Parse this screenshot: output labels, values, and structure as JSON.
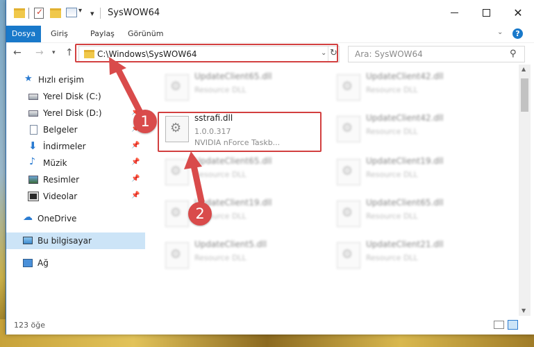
{
  "titlebar": {
    "title": "SysWOW64",
    "minimize": "—",
    "maximize": "□",
    "close": "✕"
  },
  "ribbon": {
    "tabs": [
      "Dosya",
      "Giriş",
      "Paylaş",
      "Görünüm"
    ]
  },
  "address": {
    "path": "C:\\Windows\\SysWOW64",
    "search_placeholder": "Ara: SysWOW64"
  },
  "sidebar": {
    "items": [
      {
        "label": "Hızlı erişim",
        "icon": "star-icon",
        "pinned": false
      },
      {
        "label": "Yerel Disk (C:)",
        "icon": "disk-icon",
        "pinned": true
      },
      {
        "label": "Yerel Disk (D:)",
        "icon": "disk-icon",
        "pinned": true
      },
      {
        "label": "Belgeler",
        "icon": "document-icon",
        "pinned": true
      },
      {
        "label": "İndirmeler",
        "icon": "download-icon",
        "pinned": true
      },
      {
        "label": "Müzik",
        "icon": "music-icon",
        "pinned": true
      },
      {
        "label": "Resimler",
        "icon": "pictures-icon",
        "pinned": true
      },
      {
        "label": "Videolar",
        "icon": "videos-icon",
        "pinned": true
      },
      {
        "label": "OneDrive",
        "icon": "cloud-icon",
        "pinned": false
      },
      {
        "label": "Bu bilgisayar",
        "icon": "computer-icon",
        "pinned": false,
        "selected": true
      },
      {
        "label": "Ağ",
        "icon": "network-icon",
        "pinned": false
      }
    ]
  },
  "files": {
    "left": [
      {
        "name": "UpdateClient65.dll",
        "desc": "Resource DLL"
      },
      {
        "name": "sstrafi.dll",
        "version": "1.0.0.317",
        "desc": "NVIDIA nForce Taskb..."
      },
      {
        "name": "UpdateClient65.dll",
        "desc": "Resource DLL"
      },
      {
        "name": "UpdateClient19.dll",
        "desc": "Resource DLL"
      },
      {
        "name": "UpdateClient5.dll",
        "desc": "Resource DLL"
      }
    ],
    "right": [
      {
        "name": "UpdateClient42.dll",
        "desc": "Resource DLL"
      },
      {
        "name": "UpdateClient42.dll",
        "desc": "Resource DLL"
      },
      {
        "name": "UpdateClient19.dll",
        "desc": "Resource DLL"
      },
      {
        "name": "UpdateClient65.dll",
        "desc": "Resource DLL"
      },
      {
        "name": "UpdateClient21.dll",
        "desc": "Resource DLL"
      }
    ]
  },
  "status": {
    "count": "123 öğe"
  },
  "annotations": {
    "step1": "1",
    "step2": "2",
    "color": "#d94b4b"
  },
  "colors": {
    "accent": "#1979ca",
    "selected_bg": "#cce4f7",
    "highlight": "#d23f3f"
  }
}
